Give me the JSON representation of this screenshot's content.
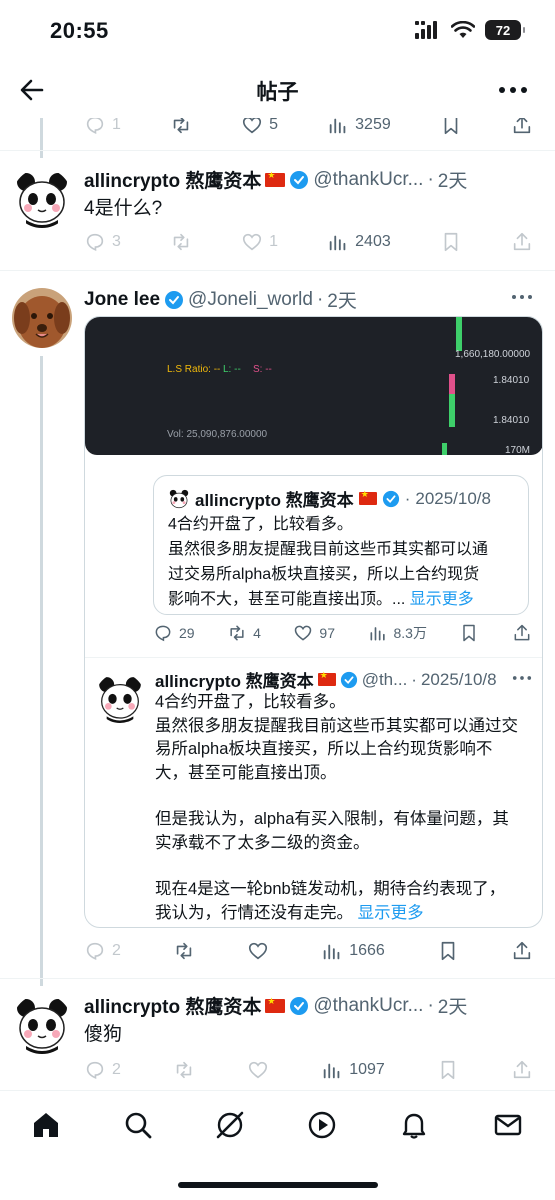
{
  "status_bar": {
    "time": "20:55",
    "battery": "72"
  },
  "nav": {
    "title": "帖子"
  },
  "top_actions": {
    "reply": "1",
    "like": "5",
    "views": "3259"
  },
  "tweet1": {
    "name": "allincrypto 熬鹰资本",
    "handle": "@thankUcr...",
    "dot": "·",
    "time": "2天",
    "text": "4是什么?",
    "reply": "3",
    "like": "1",
    "views": "2403"
  },
  "tweet2": {
    "name": "Jone lee",
    "handle": "@Joneli_world",
    "dot": "·",
    "time": "2天",
    "chart": {
      "price": "1,660,180.00000",
      "ls_ratio": "L.S Ratio: --",
      "l_label": "L: --",
      "s_label": "S: --",
      "val1": "1.84010",
      "val2": "1.84010",
      "vol": "Vol: 25,090,876.00000",
      "vol_axis": "170M"
    },
    "quote": {
      "name": "allincrypto 熬鹰资本",
      "time": "2025/10/8",
      "line1": "4合约开盘了，比较看多。",
      "line2": "虽然很多朋友提醒我目前这些币其实都可以通",
      "line3": "过交易所alpha板块直接买，所以上合约现货",
      "line4_text": "影响不大，甚至可能直接出顶。...",
      "show_more": "显示更多"
    },
    "embed_actions": {
      "reply": "29",
      "retweet": "4",
      "like": "97",
      "views": "8.3万"
    },
    "nested": {
      "name": "allincrypto 熬鹰资本",
      "handle": "@th...",
      "time": "2025/10/8",
      "p1": "4合约开盘了，比较看多。",
      "p2a": "虽然很多朋友提醒我目前这些币其实都可以通过交",
      "p2b": "易所alpha板块直接买，所以上合约现货影响不",
      "p2c": "大，甚至可能直接出顶。",
      "p3a": "但是我认为，alpha有买入限制，有体量问题，其",
      "p3b": "实承载不了太多二级的资金。",
      "p4a": "现在4是这一轮bnb链发动机，期待合约表现了，",
      "p4b": "我认为，行情还没有走完。",
      "show_more": "显示更多"
    },
    "reply": "2",
    "views": "1666"
  },
  "tweet3": {
    "name": "allincrypto 熬鹰资本",
    "handle": "@thankUcr...",
    "dot": "·",
    "time": "2天",
    "text": "傻狗",
    "reply": "2",
    "views": "1097"
  },
  "colors": {
    "accent": "#1d9bf0",
    "muted": "#536471",
    "border": "#cfd9de",
    "chart_bg": "#1e2127"
  }
}
